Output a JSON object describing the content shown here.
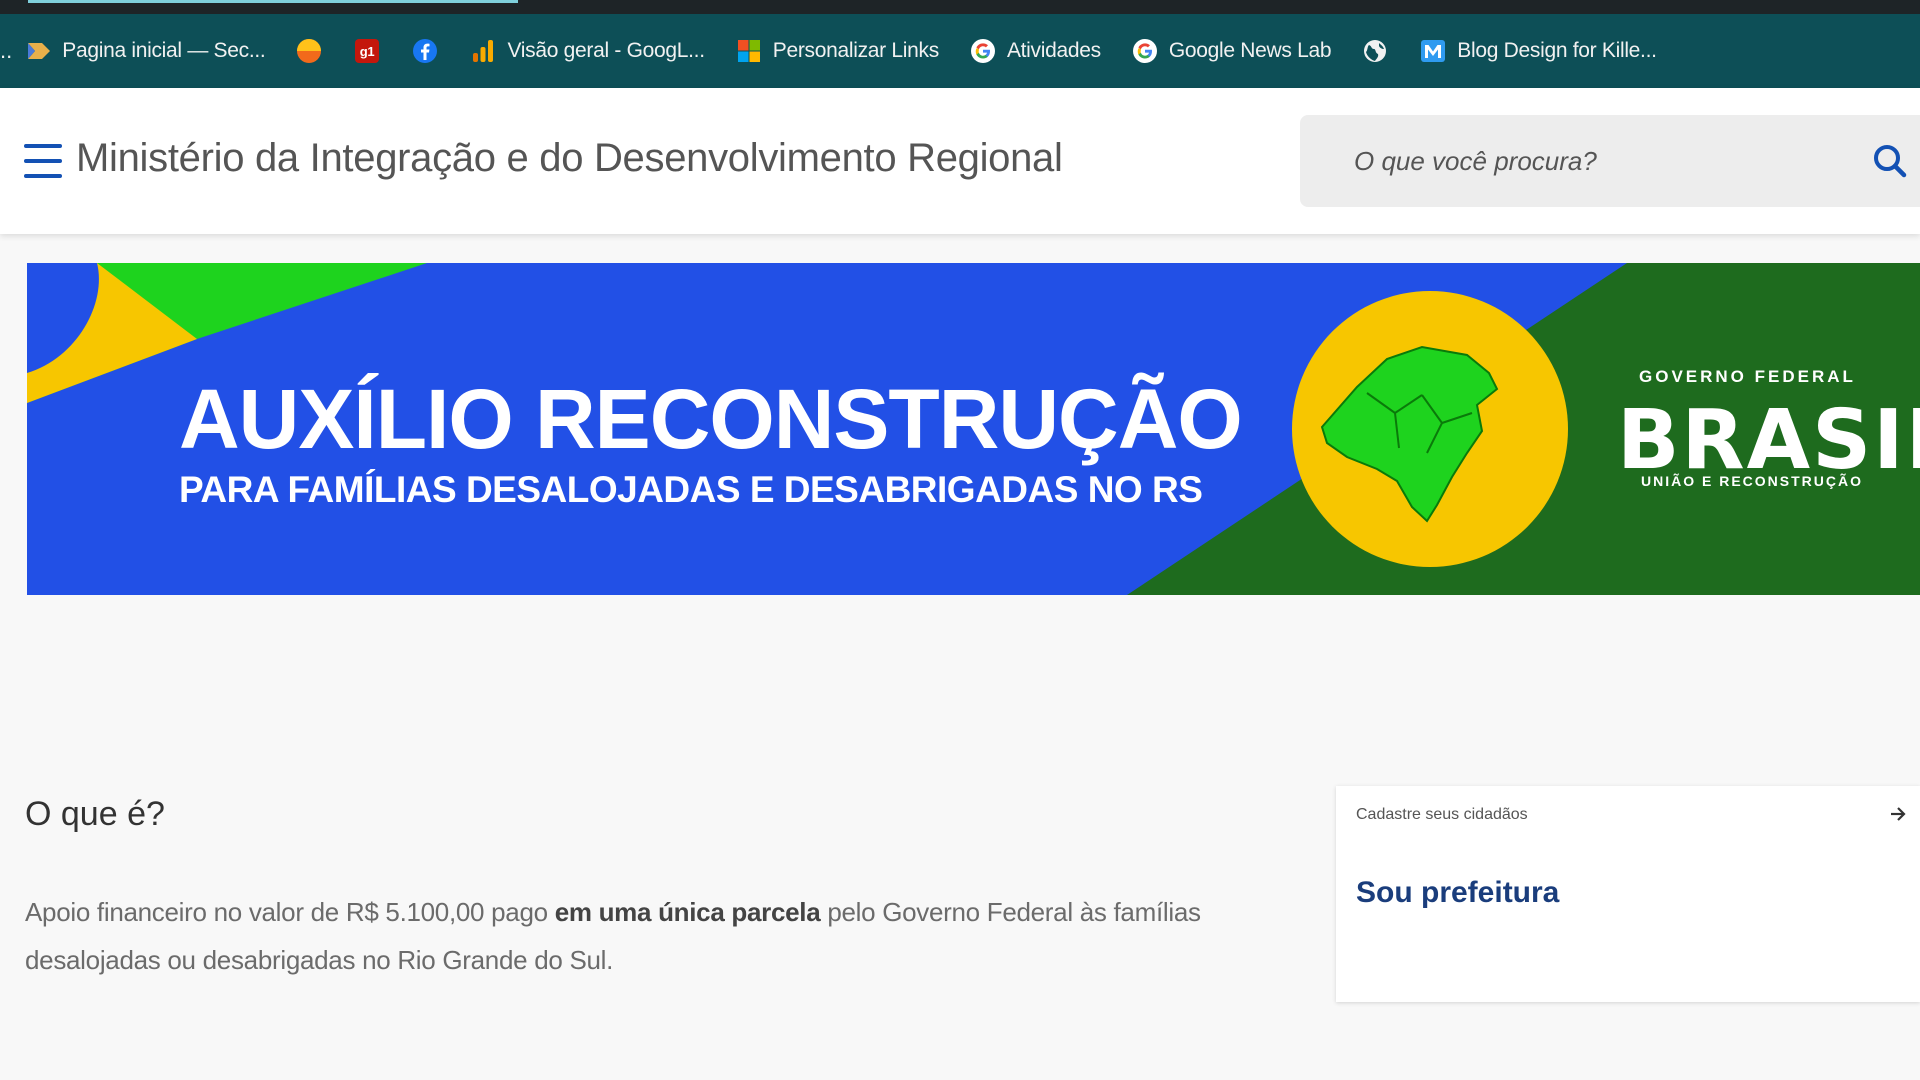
{
  "browser": {
    "overflow_glyph": "..",
    "bookmarks": [
      {
        "label": "Pagina inicial — Sec...",
        "icon": "arrow-logo-icon"
      },
      {
        "label": "",
        "icon": "orange-circle-icon"
      },
      {
        "label": "",
        "icon": "g1-icon",
        "badge": "g1"
      },
      {
        "label": "",
        "icon": "facebook-icon",
        "badge": "f"
      },
      {
        "label": "Visão geral - GoogL...",
        "icon": "analytics-icon"
      },
      {
        "label": "Personalizar Links",
        "icon": "microsoft-icon"
      },
      {
        "label": "Atividades",
        "icon": "google-icon"
      },
      {
        "label": "Google News Lab",
        "icon": "google-icon"
      },
      {
        "label": "",
        "icon": "globe-icon"
      },
      {
        "label": "Blog Design for Kille...",
        "icon": "m-logo-icon",
        "badge": "M"
      }
    ]
  },
  "header": {
    "title": "Ministério da Integração e do Desenvolvimento Regional",
    "search_placeholder": "O que você procura?"
  },
  "banner": {
    "title": "AUXÍLIO RECONSTRUÇÃO",
    "subtitle": "PARA FAMÍLIAS DESALOJADAS E DESABRIGADAS NO RS",
    "gov_top": "GOVERNO FEDERAL",
    "gov_brand": "BRASIL",
    "gov_bottom": "UNIÃO E RECONSTRUÇÃO",
    "colors": {
      "blue": "#2250e6",
      "green": "#1e6b1e",
      "yellow": "#f7c600",
      "bright_green": "#1ed31e"
    }
  },
  "content": {
    "section_title": "O que é?",
    "text_part1": "Apoio financeiro no valor de R$ 5.100,00 pago ",
    "text_bold": "em uma única parcela",
    "text_part2": " pelo Governo Federal às famílias desalojadas ou desabrigadas no Rio Grande do Sul."
  },
  "card": {
    "small_label": "Cadastre seus cidadãos",
    "title": "Sou prefeitura"
  }
}
